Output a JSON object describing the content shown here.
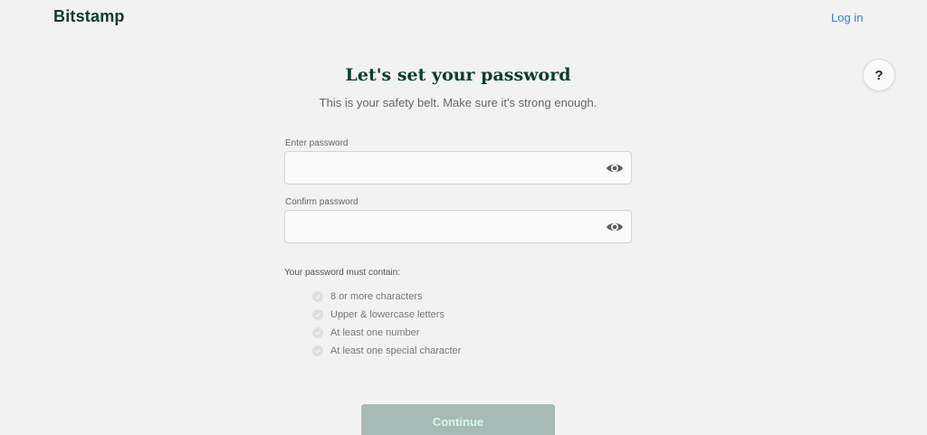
{
  "header": {
    "logo_text": "Bitstamp",
    "login_label": "Log in",
    "help_label": "?"
  },
  "main": {
    "title": "Let's set your password",
    "subtitle": "This is your safety belt. Make sure it's strong enough.",
    "password_field": {
      "label": "Enter password",
      "value": "",
      "placeholder": ""
    },
    "confirm_field": {
      "label": "Confirm password",
      "value": "",
      "placeholder": ""
    },
    "rules_heading": "Your password must contain:",
    "rules": [
      {
        "label": "8 or more characters",
        "met": false
      },
      {
        "label": "Upper & lowercase letters",
        "met": false
      },
      {
        "label": "At least one number",
        "met": false
      },
      {
        "label": "At least one special character",
        "met": false
      }
    ],
    "continue_label": "Continue"
  },
  "icons": {
    "password_toggle": "eye-icon",
    "rule_status": "check-circle-icon"
  },
  "colors": {
    "brand": "#0b3d2e",
    "link": "#3b7dd8",
    "button_disabled_bg": "#a7bab5",
    "button_disabled_text": "#d7f7e8",
    "background": "#f2f2f2"
  }
}
